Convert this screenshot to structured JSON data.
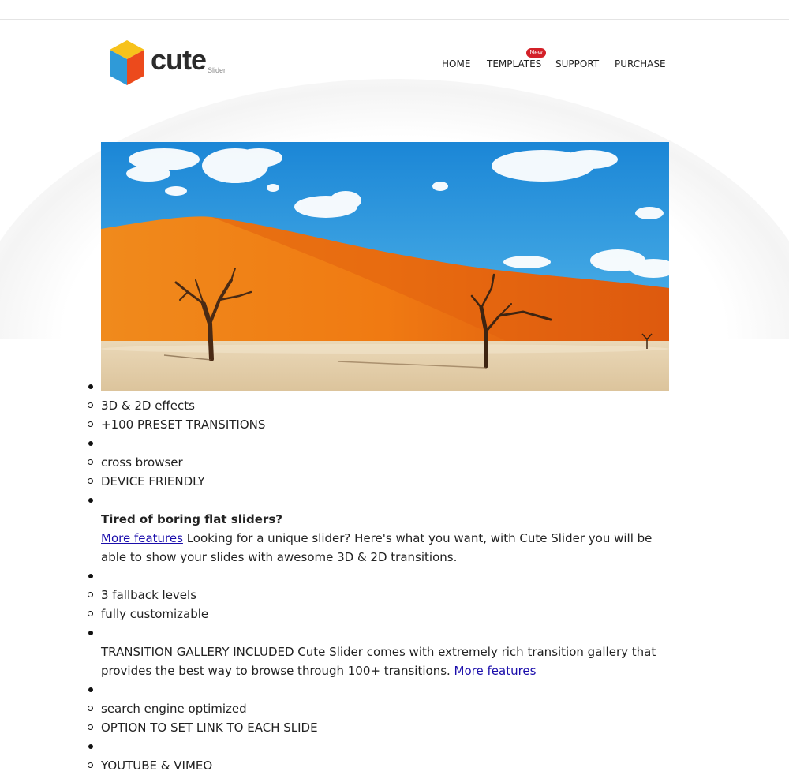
{
  "logo": {
    "word": "cute",
    "sub": "Slider"
  },
  "nav": {
    "items": [
      "HOME",
      "TEMPLATES",
      "SUPPORT",
      "PURCHASE"
    ],
    "badge": "New"
  },
  "content": {
    "group1": [
      "3D & 2D effects",
      "+100 PRESET TRANSITIONS"
    ],
    "group2": [
      "cross browser",
      "DEVICE FRIENDLY"
    ],
    "block1": {
      "heading": "Tired of boring flat sliders?",
      "link": "More features",
      "text_line1": " Looking for a unique slider? Here's what you want, with Cute Slider you will be",
      "text_line2": "able to show your slides with awesome 3D & 2D transitions."
    },
    "group3": [
      "3 fallback levels",
      "fully customizable"
    ],
    "block2": {
      "text_line1": "TRANSITION GALLERY INCLUDED Cute Slider comes with extremely rich transition gallery that",
      "text_line2": "provides the best way to browse through 100+ transitions. ",
      "link": "More features"
    },
    "group4": [
      "search engine optimized",
      "OPTION TO SET LINK TO EACH SLIDE"
    ],
    "group5": [
      "YOUTUBE & VIMEO"
    ]
  },
  "colors": {
    "badge": "#d32028",
    "link": "#1a0dab",
    "sky": "#1f8fd8",
    "dune": "#e8761a",
    "ground": "#e2cfae"
  }
}
